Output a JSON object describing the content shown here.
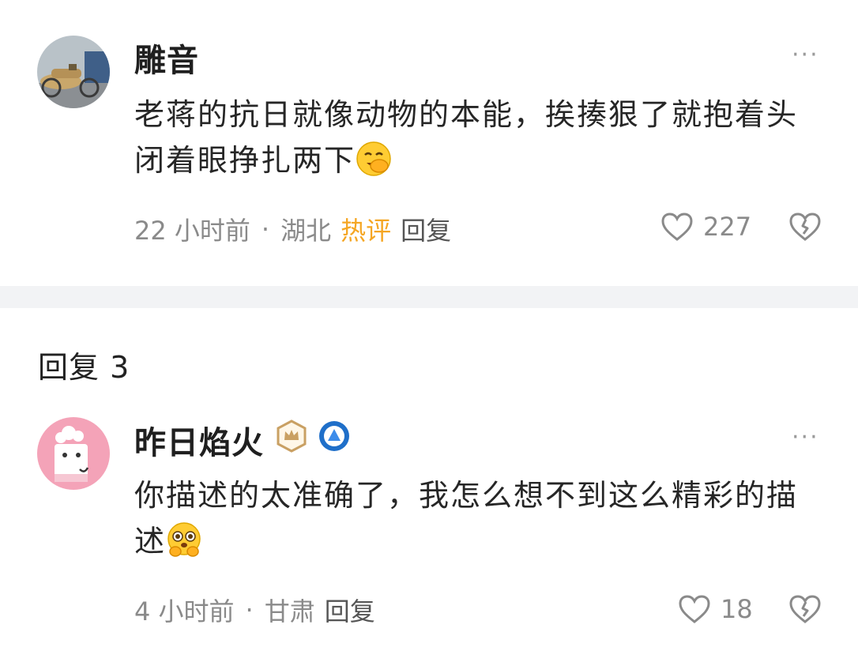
{
  "comment": {
    "username": "雕音",
    "text": "老蒋的抗日就像动物的本能，挨揍狠了就抱着头闭着眼挣扎两下",
    "emoji": "grinning-cover-mouth-emoji",
    "time": "22 小时前",
    "separator": "·",
    "location": "湖北",
    "hot_label": "热评",
    "reply_label": "回复",
    "like_count": "227",
    "more_label": "···"
  },
  "replies_header": "回复 3",
  "reply": {
    "username": "昨日焰火",
    "badges": [
      "crown-badge-icon",
      "level-badge-icon"
    ],
    "text": "你描述的太准确了，我怎么想不到这么精彩的描述",
    "emoji": "pleading-hands-emoji",
    "time": "4 小时前",
    "separator": "·",
    "location": "甘肃",
    "reply_label": "回复",
    "like_count": "18",
    "more_label": "···"
  },
  "colors": {
    "hot": "#f5a623",
    "meta": "#8a8a8a",
    "divider": "#f2f3f5",
    "crown_badge": "#c9a063",
    "level_badge": "#1f6fc9"
  }
}
